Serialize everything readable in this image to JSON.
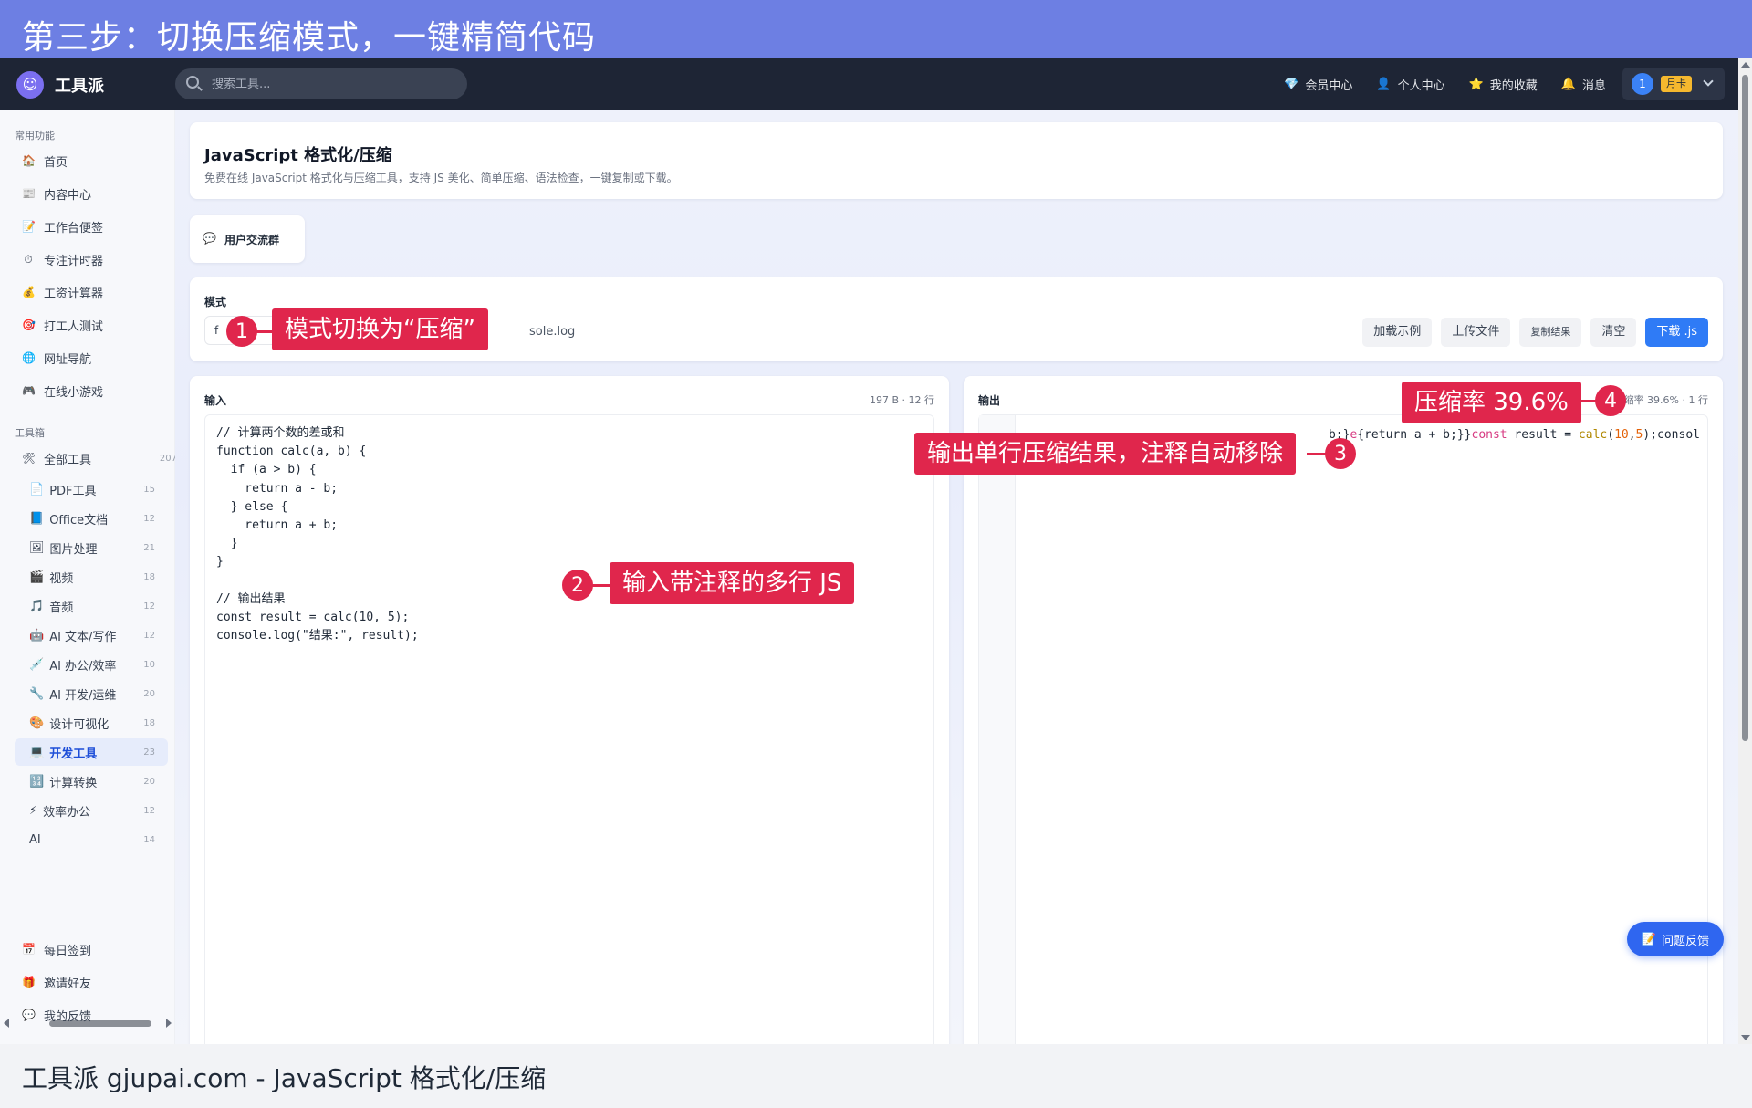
{
  "banner": {
    "text": "第三步：切换压缩模式，一键精简代码"
  },
  "nav": {
    "logo_char": "☺",
    "app_name": "工具派",
    "search_placeholder": "搜索工具...",
    "links": [
      {
        "icon": "💎",
        "label": "会员中心"
      },
      {
        "icon": "👤",
        "label": "个人中心"
      },
      {
        "icon": "⭐",
        "label": "我的收藏"
      },
      {
        "icon": "🔔",
        "label": "消息"
      }
    ],
    "user": {
      "avatar": "1",
      "badge": "月卡"
    }
  },
  "sidebar": {
    "common_title": "常用功能",
    "common": [
      {
        "icon": "🏠",
        "label": "首页"
      },
      {
        "icon": "📰",
        "label": "内容中心"
      },
      {
        "icon": "📝",
        "label": "工作台便签"
      },
      {
        "icon": "⏱",
        "label": "专注计时器"
      },
      {
        "icon": "💰",
        "label": "工资计算器"
      },
      {
        "icon": "🎯",
        "label": "打工人测试"
      },
      {
        "icon": "🌐",
        "label": "网址导航"
      },
      {
        "icon": "🎮",
        "label": "在线小游戏"
      }
    ],
    "tools_title": "工具箱",
    "all_tools": {
      "icon": "🛠",
      "label": "全部工具",
      "count": "207"
    },
    "tools": [
      {
        "icon": "📄",
        "label": "PDF工具",
        "count": "15"
      },
      {
        "icon": "📘",
        "label": "Office文档",
        "count": "12"
      },
      {
        "icon": "🖼",
        "label": "图片处理",
        "count": "21"
      },
      {
        "icon": "🎬",
        "label": "视频",
        "count": "18"
      },
      {
        "icon": "🎵",
        "label": "音频",
        "count": "12"
      },
      {
        "icon": "🤖",
        "label": "AI 文本/写作",
        "count": "12"
      },
      {
        "icon": "💉",
        "label": "AI 办公/效率",
        "count": "10"
      },
      {
        "icon": "🔧",
        "label": "AI 开发/运维",
        "count": "20"
      },
      {
        "icon": "🎨",
        "label": "设计可视化",
        "count": "18"
      },
      {
        "icon": "💻",
        "label": "开发工具",
        "count": "23"
      },
      {
        "icon": "🔢",
        "label": "计算转换",
        "count": "20"
      },
      {
        "icon": "⚡",
        "label": "效率办公",
        "count": "12"
      },
      {
        "icon": "",
        "label": "AI",
        "count": "14"
      }
    ],
    "bottom": [
      {
        "icon": "📅",
        "label": "每日签到"
      },
      {
        "icon": "🎁",
        "label": "邀请好友"
      },
      {
        "icon": "💬",
        "label": "我的反馈"
      }
    ]
  },
  "header": {
    "title": "JavaScript 格式化/压缩",
    "subtitle": "免费在线 JavaScript 格式化与压缩工具，支持 JS 美化、简单压缩、语法检查，一键复制或下载。"
  },
  "group": {
    "icon": "💬",
    "label": "用户交流群"
  },
  "mode": {
    "label": "模式",
    "select_value": "f",
    "hint": "sole.log"
  },
  "buttons": {
    "load_example": "加载示例",
    "upload": "上传文件",
    "copy": "复制结果",
    "clear": "清空",
    "download": "下载 .js"
  },
  "input_pane": {
    "label": "输入",
    "stats": "197 B · 12 行",
    "code": "// 计算两个数的差或和\nfunction calc(a, b) {\n  if (a > b) {\n    return a - b;\n  } else {\n    return a + b;\n  }\n}\n\n// 输出结果\nconst result = calc(10, 5);\nconsole.log(\"结果:\", result);"
  },
  "output_pane": {
    "label": "输出",
    "stats": "缩率 39.6% · 1 行",
    "code_parts": {
      "p1": "b;}",
      "p2": "e",
      "p3": "{return a + b;}}",
      "p4": "const",
      "p5": " result = ",
      "p6": "calc",
      "p7": "(",
      "p8": "10",
      "p9": ",",
      "p10": "5",
      "p11": ");consol"
    }
  },
  "feedback": {
    "icon": "📝",
    "label": "问题反馈"
  },
  "annotations": [
    {
      "num": "1",
      "text": "模式切换为“压缩”"
    },
    {
      "num": "2",
      "text": "输入带注释的多行 JS"
    },
    {
      "num": "3",
      "text": "输出单行压缩结果，注释自动移除"
    },
    {
      "num": "4",
      "text": "压缩率 39.6%"
    }
  ],
  "footer": {
    "text": "工具派 gjupai.com - JavaScript 格式化/压缩"
  },
  "colors": {
    "banner": "#6d7fe3",
    "nav": "#1e2535",
    "accent": "#2f7bf6",
    "annotation": "#e0264c"
  }
}
